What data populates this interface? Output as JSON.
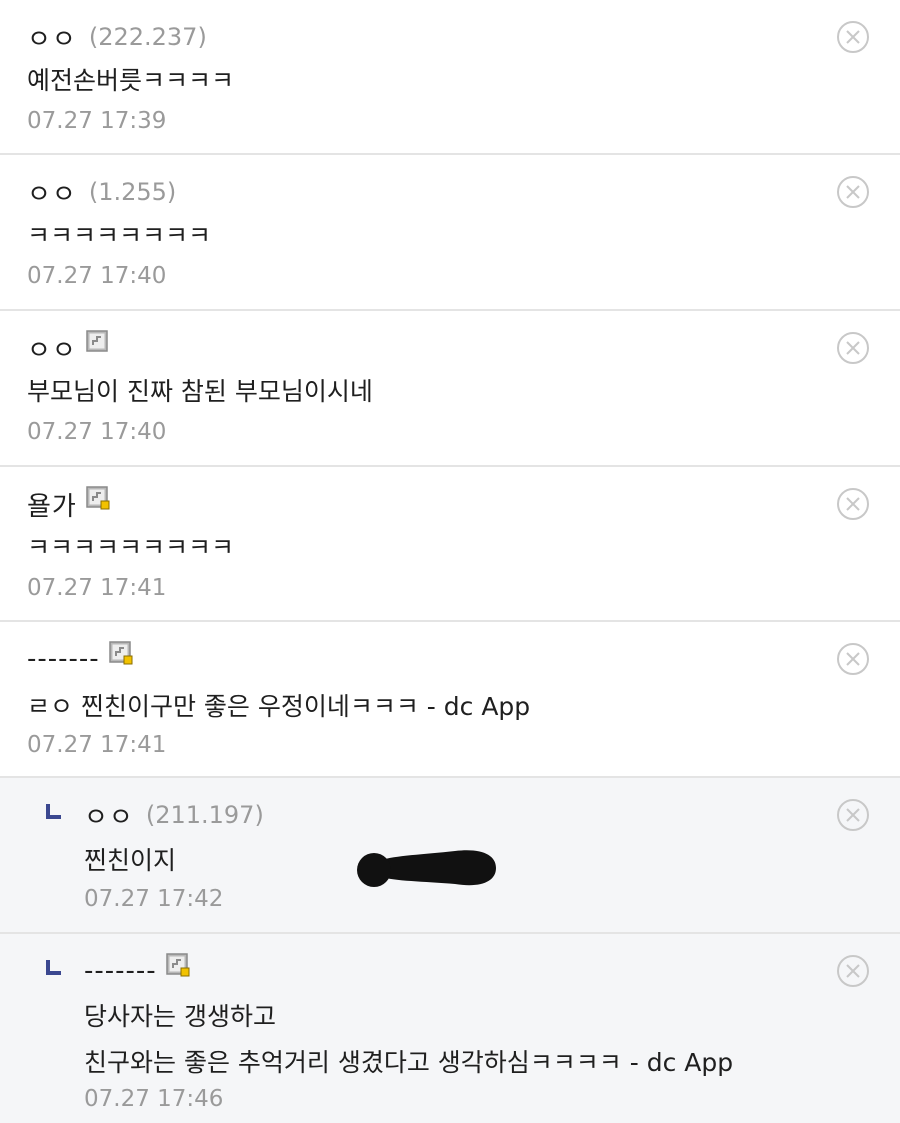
{
  "comments": [
    {
      "nickname": "ㅇㅇ",
      "ip": "(222.237)",
      "lines": [
        "예전손버릇ㅋㅋㅋㅋ"
      ],
      "time": "07.27 17:39",
      "badge": "none",
      "reply": false
    },
    {
      "nickname": "ㅇㅇ",
      "ip": "(1.255)",
      "lines": [
        "ㅋㅋㅋㅋㅋㅋㅋㅋ"
      ],
      "time": "07.27 17:40",
      "badge": "none",
      "reply": false
    },
    {
      "nickname": "ㅇㅇ",
      "ip": "",
      "lines": [
        "부모님이 진짜 참된 부모님이시네"
      ],
      "time": "07.27 17:40",
      "badge": "fixed-nick-icon",
      "reply": false
    },
    {
      "nickname": "욜가",
      "ip": "",
      "lines": [
        "ㅋㅋㅋㅋㅋㅋㅋㅋㅋ"
      ],
      "time": "07.27 17:41",
      "badge": "semi-fixed-nick-icon",
      "reply": false
    },
    {
      "nickname": "-------",
      "ip": "",
      "lines": [
        "ㄹㅇ 찐친이구만 좋은 우정이네ㅋㅋㅋ - dc App"
      ],
      "time": "07.27 17:41",
      "badge": "semi-fixed-nick-icon",
      "reply": false
    },
    {
      "nickname": "ㅇㅇ",
      "ip": "(211.197)",
      "lines": [
        "찐친이지"
      ],
      "time": "07.27 17:42",
      "badge": "none",
      "reply": true
    },
    {
      "nickname": "-------",
      "ip": "",
      "lines": [
        "당사자는 갱생하고",
        "친구와는 좋은 추억거리 생겼다고 생각하심ㅋㅋㅋㅋ - dc App"
      ],
      "time": "07.27 17:46",
      "badge": "semi-fixed-nick-icon",
      "reply": true
    }
  ],
  "icons": {
    "delete": "close-circle-icon",
    "reply": "reply-arrow-icon"
  },
  "colors": {
    "divider": "#e4e4e4",
    "reply_bg": "#f5f6f8",
    "meta_gray": "#9a9a9a",
    "reply_arrow": "#3b4890",
    "badge_dot": "#f2c200"
  }
}
